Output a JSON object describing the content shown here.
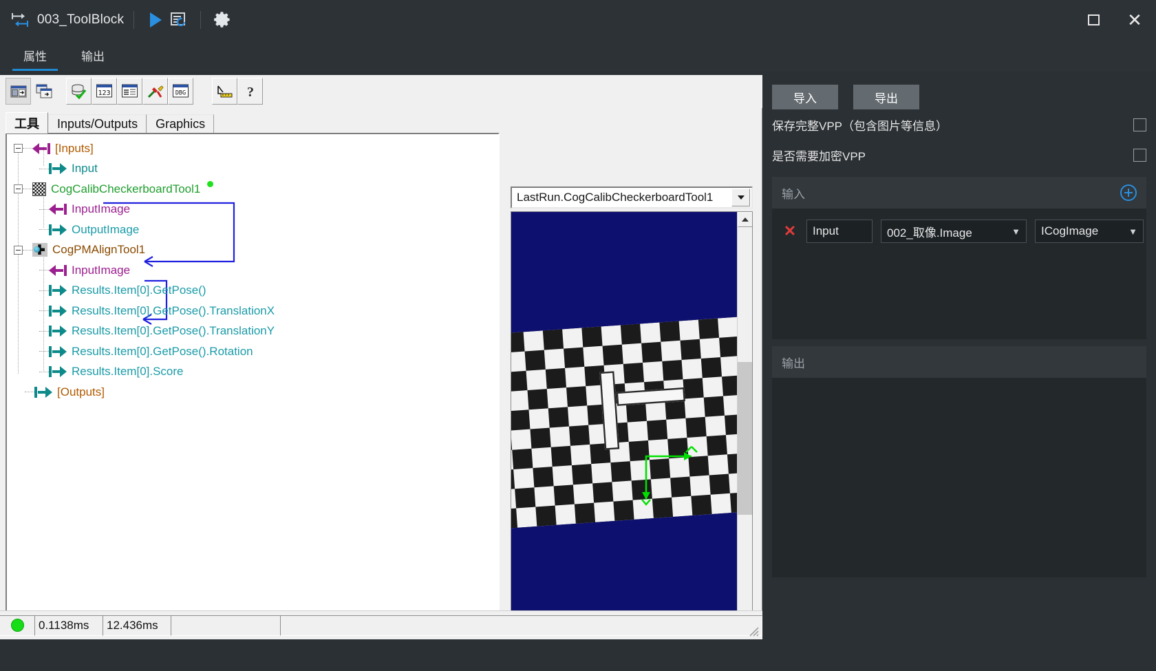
{
  "titlebar": {
    "icon": "toolblock-icon",
    "title": "003_ToolBlock",
    "run_icon": "play-icon",
    "reset_icon": "run-once-icon",
    "settings_icon": "gear-icon",
    "maximize_icon": "maximize-icon",
    "close_icon": "close-icon"
  },
  "tabs": [
    {
      "label": "属性",
      "active": true
    },
    {
      "label": "输出",
      "active": false
    }
  ],
  "cognex_toolbar": {
    "buttons": [
      {
        "name": "show-tool-dialog-icon",
        "pressed": true
      },
      {
        "name": "show-all-dialogs-icon",
        "pressed": false
      },
      {
        "name": "database-check-icon",
        "pressed": false
      },
      {
        "name": "numeric-123-icon",
        "pressed": false
      },
      {
        "name": "properties-list-icon",
        "pressed": false
      },
      {
        "name": "tools-hammer-icon",
        "pressed": false
      },
      {
        "name": "debug-dbg-icon",
        "pressed": false
      },
      {
        "name": "measure-ruler-icon",
        "pressed": false
      },
      {
        "name": "help-question-icon",
        "pressed": false
      }
    ]
  },
  "inner_tabs": [
    {
      "label": "工具",
      "active": true
    },
    {
      "label": "Inputs/Outputs",
      "active": false
    },
    {
      "label": "Graphics",
      "active": false
    }
  ],
  "tree": [
    {
      "label": "[Inputs]",
      "indent": 0,
      "expander": true,
      "icon": "arrow-in-magenta",
      "color": "c-inputs",
      "badge": false
    },
    {
      "label": "Input",
      "indent": 1,
      "expander": false,
      "icon": "arrow-out-teal",
      "color": "c-teal",
      "badge": false
    },
    {
      "label": "CogCalibCheckerboardTool1",
      "indent": 0,
      "expander": true,
      "icon": "checkerboard-icon",
      "color": "c-green",
      "badge": true
    },
    {
      "label": "InputImage",
      "indent": 1,
      "expander": false,
      "icon": "arrow-in-purple",
      "color": "c-magenta",
      "badge": false
    },
    {
      "label": "OutputImage",
      "indent": 1,
      "expander": false,
      "icon": "arrow-out-teal",
      "color": "c-cyan",
      "badge": false
    },
    {
      "label": "CogPMAlignTool1",
      "indent": 0,
      "expander": true,
      "icon": "pmalign-icon",
      "color": "c-brown",
      "badge": false
    },
    {
      "label": "InputImage",
      "indent": 1,
      "expander": false,
      "icon": "arrow-in-purple",
      "color": "c-magenta",
      "badge": false
    },
    {
      "label": "Results.Item[0].GetPose()",
      "indent": 1,
      "expander": false,
      "icon": "arrow-out-teal",
      "color": "c-cyan",
      "badge": false
    },
    {
      "label": "Results.Item[0].GetPose().TranslationX",
      "indent": 1,
      "expander": false,
      "icon": "arrow-out-teal",
      "color": "c-cyan",
      "badge": false
    },
    {
      "label": "Results.Item[0].GetPose().TranslationY",
      "indent": 1,
      "expander": false,
      "icon": "arrow-out-teal",
      "color": "c-cyan",
      "badge": false
    },
    {
      "label": "Results.Item[0].GetPose().Rotation",
      "indent": 1,
      "expander": false,
      "icon": "arrow-out-teal",
      "color": "c-cyan",
      "badge": false
    },
    {
      "label": "Results.Item[0].Score",
      "indent": 1,
      "expander": false,
      "icon": "arrow-out-teal",
      "color": "c-cyan",
      "badge": false
    },
    {
      "label": "[Outputs]",
      "indent": 0,
      "expander": false,
      "icon": "arrow-out-teal",
      "color": "c-inputs",
      "badge": false
    }
  ],
  "viewer": {
    "selected_record": "LastRun.CogCalibCheckerboardTool1",
    "dropdown_icon": "chevron-down-icon",
    "vscroll_up_icon": "scroll-up-icon",
    "vscroll_down_icon": "scroll-down-icon",
    "hscroll_left_icon": "scroll-left-icon",
    "hscroll_right_icon": "scroll-right-icon",
    "image_background_color": "#0e1070",
    "overlay_color": "#00e000"
  },
  "statusbar": {
    "led_color": "#16dd16",
    "time_1": "0.1138ms",
    "time_2": "12.436ms",
    "cell_3": "",
    "cell_4": ""
  },
  "right_panel": {
    "import_label": "导入",
    "export_label": "导出",
    "options": [
      {
        "label": "保存完整VPP（包含图片等信息）",
        "checked": false
      },
      {
        "label": "是否需要加密VPP",
        "checked": false
      }
    ],
    "input_section": {
      "title": "输入",
      "add_icon": "add-circle-icon",
      "rows": [
        {
          "delete_icon": "delete-x-icon",
          "name": "Input",
          "source": "002_取像.Image",
          "type": "ICogImage"
        }
      ]
    },
    "output_section": {
      "title": "输出",
      "rows": []
    },
    "accent_color": "#2a8fe0"
  }
}
